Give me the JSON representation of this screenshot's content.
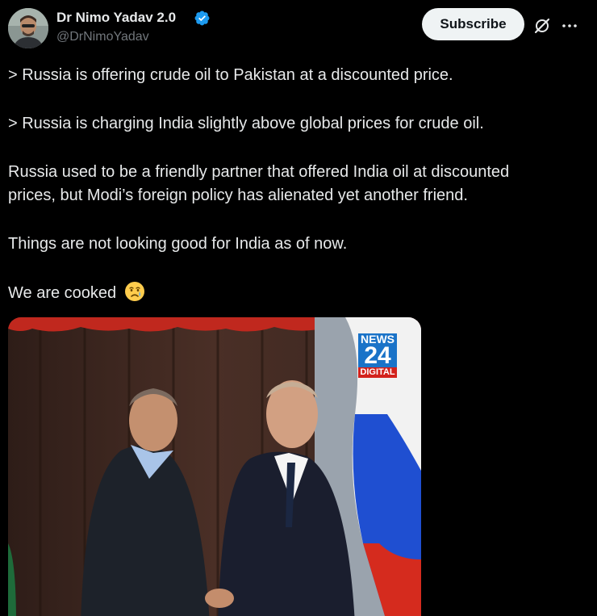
{
  "author": {
    "name": "Dr Nimo Yadav 2.0",
    "handle": "@DrNimoYadav",
    "verified": true
  },
  "actions": {
    "subscribe_label": "Subscribe"
  },
  "post": {
    "lines": [
      "> Russia is offering crude oil to Pakistan at a discounted price.",
      "> Russia is charging India slightly above global prices for crude oil.",
      "Russia used to be a friendly partner that offered India oil at discounted",
      "prices, but Modi’s foreign policy has alienated yet another friend.",
      "Things are not looking good for India as of now.",
      "We are cooked"
    ],
    "emoji": "crying-face"
  },
  "media": {
    "logo_top": "NEWS",
    "logo_number": "24",
    "logo_bottom": "DIGITAL"
  },
  "colors": {
    "background": "#000000",
    "text_primary": "#e7e9ea",
    "text_secondary": "#71767b",
    "verified_blue": "#1d9bf0",
    "button_bg": "#eff3f4"
  }
}
